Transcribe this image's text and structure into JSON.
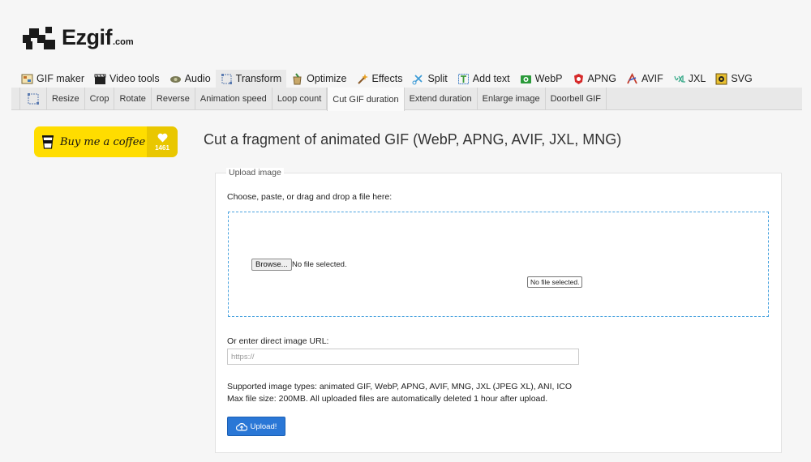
{
  "logo": {
    "name": "Ezgif",
    "suffix": ".com"
  },
  "main_nav": [
    {
      "label": "GIF maker",
      "icon": "gif-maker-icon"
    },
    {
      "label": "Video tools",
      "icon": "clapperboard-icon"
    },
    {
      "label": "Audio",
      "icon": "audio-icon"
    },
    {
      "label": "Transform",
      "icon": "transform-icon"
    },
    {
      "label": "Optimize",
      "icon": "optimize-icon"
    },
    {
      "label": "Effects",
      "icon": "effects-wand-icon"
    },
    {
      "label": "Split",
      "icon": "split-scissors-icon"
    },
    {
      "label": "Add text",
      "icon": "add-text-icon"
    },
    {
      "label": "WebP",
      "icon": "webp-icon"
    },
    {
      "label": "APNG",
      "icon": "apng-icon"
    },
    {
      "label": "AVIF",
      "icon": "avif-icon"
    },
    {
      "label": "JXL",
      "icon": "jxl-icon"
    },
    {
      "label": "SVG",
      "icon": "svg-icon"
    }
  ],
  "sub_nav": [
    "Resize",
    "Crop",
    "Rotate",
    "Reverse",
    "Animation speed",
    "Loop count",
    "Cut GIF duration",
    "Extend duration",
    "Enlarge image",
    "Doorbell GIF"
  ],
  "coffee": {
    "label": "Buy me a coffee",
    "count": "1461"
  },
  "title": "Cut a fragment of animated GIF (WebP, APNG, AVIF, JXL, MNG)",
  "upload": {
    "legend": "Upload image",
    "choose_label": "Choose, paste, or drag and drop a file here:",
    "browse_label": "Browse...",
    "no_file": "No file selected.",
    "tooltip": "No file selected.",
    "url_label": "Or enter direct image URL:",
    "url_placeholder": "https://",
    "supported": "Supported image types: animated GIF, WebP, APNG, AVIF, MNG, JXL (JPEG XL), ANI, ICO",
    "max_size": "Max file size: 200MB. All uploaded files are automatically deleted 1 hour after upload.",
    "button_label": "Upload!"
  },
  "colors": {
    "accent": "#2a77d6",
    "dropzone_border": "#4aa3df",
    "coffee_yellow": "#ffdd00"
  }
}
